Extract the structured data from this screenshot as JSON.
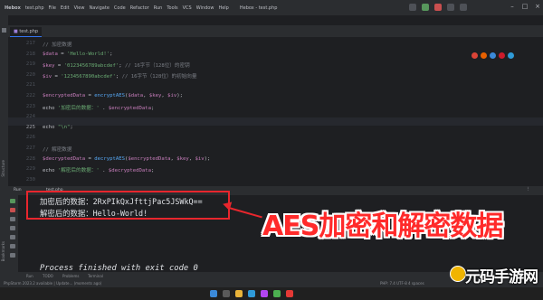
{
  "menu": {
    "items": [
      "Hebox",
      "test.php",
      "File",
      "Edit",
      "View",
      "Navigate",
      "Code",
      "Refactor",
      "Run",
      "Tools",
      "VCS",
      "Window",
      "Help",
      "Hebox - test.php"
    ]
  },
  "tabs": [
    {
      "label": "test.php"
    }
  ],
  "editor": {
    "lines": [
      {
        "num": "217",
        "text": "// 加密数据",
        "kind": "comment"
      },
      {
        "num": "218",
        "text": "$data = 'Hello-World!';",
        "kind": "code"
      },
      {
        "num": "219",
        "text": "$key = '0123456789abcdef'; // 16字节（128位）的密钥",
        "kind": "code"
      },
      {
        "num": "220",
        "text": "$iv = '1234567890abcdef'; // 16字节（128位）的初始向量",
        "kind": "code"
      },
      {
        "num": "221",
        "text": "",
        "kind": "code"
      },
      {
        "num": "222",
        "text": "$encryptedData = encryptAES($data, $key, $iv);",
        "kind": "code"
      },
      {
        "num": "223",
        "text": "echo '加密后的数据：' . $encryptedData;",
        "kind": "code"
      },
      {
        "num": "224",
        "text": "",
        "kind": "code"
      },
      {
        "num": "225",
        "text": "echo \"\\n\";",
        "kind": "current"
      },
      {
        "num": "226",
        "text": "",
        "kind": "code"
      },
      {
        "num": "227",
        "text": "// 解密数据",
        "kind": "comment"
      },
      {
        "num": "228",
        "text": "$decryptedData = decryptAES($encryptedData, $key, $iv);",
        "kind": "code"
      },
      {
        "num": "229",
        "text": "echo '解密后的数据：' . $decryptedData;",
        "kind": "code"
      },
      {
        "num": "230",
        "text": "",
        "kind": "code"
      }
    ]
  },
  "run": {
    "label": "Run",
    "tab": "test.php"
  },
  "console": {
    "line1": "加密后的数据：2RxPIkQxJfttjPac5JSWkQ==",
    "line2": "解密后的数据：Hello-World!",
    "finish": "Process finished with exit code 0"
  },
  "annotation": {
    "caption": "AES加密和解密数据",
    "box_color": "#e8262d"
  },
  "bottom_tools": {
    "items": [
      "Run",
      "TODO",
      "Problems",
      "Terminal"
    ]
  },
  "status": {
    "left": "PhpStorm 2023.2 available | Update... (moments ago)",
    "right": "PHP: 7.4  UTF-8  4 spaces"
  },
  "watermark": {
    "text": "元码手游网"
  },
  "colors": {
    "accent": "#3574f0",
    "annotation_red": "#ff2a2a"
  }
}
